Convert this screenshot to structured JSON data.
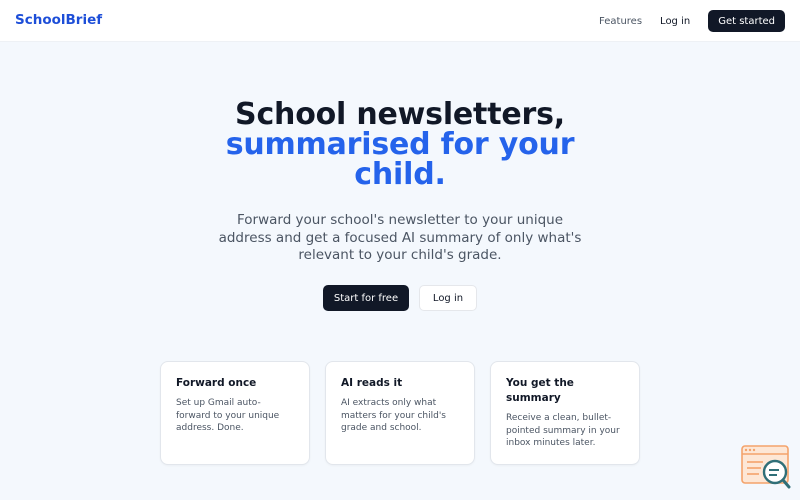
{
  "nav": {
    "brand": "SchoolBrief",
    "features": "Features",
    "login": "Log in",
    "cta": "Get started"
  },
  "hero": {
    "title_line1": "School newsletters,",
    "title_line2": "summarised for your",
    "title_line3": "child.",
    "subtitle": "Forward your school's newsletter to your unique address and get a focused AI summary of only what's relevant to your child's grade.",
    "primary_cta": "Start for free",
    "secondary_cta": "Log in"
  },
  "features": [
    {
      "title": "Forward once",
      "body": "Set up Gmail auto-forward to your unique address. Done."
    },
    {
      "title": "AI reads it",
      "body": "AI extracts only what matters for your child's grade and school."
    },
    {
      "title": "You get the summary",
      "body": "Receive a clean, bullet-pointed summary in your inbox minutes later."
    }
  ],
  "colors": {
    "brand": "#1d4ed8",
    "accent": "#2563eb",
    "dark": "#111827",
    "background": "#f4f8fd",
    "widget_orange": "#f4a36b",
    "widget_teal": "#2f6f78"
  },
  "icons": {
    "widget": "search-feedback-icon"
  }
}
